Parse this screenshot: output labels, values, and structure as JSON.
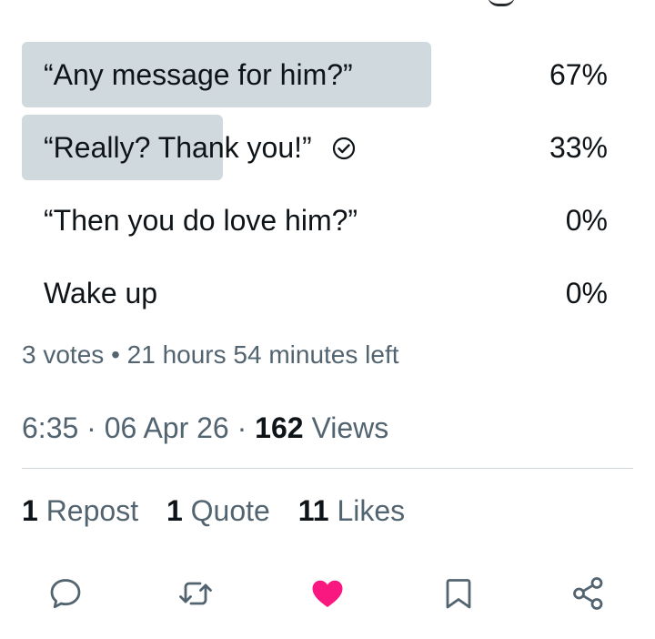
{
  "poll": {
    "options": [
      {
        "label": "“Any message for him?”",
        "percent": "67%",
        "share": 0.67,
        "voted": false
      },
      {
        "label": "“Really? Thank you!”",
        "percent": "33%",
        "share": 0.33,
        "voted": true
      },
      {
        "label": "“Then you do love him?”",
        "percent": "0%",
        "share": 0,
        "voted": false
      },
      {
        "label": "Wake up",
        "percent": "0%",
        "share": 0,
        "voted": false
      }
    ],
    "votes": "3 votes",
    "separator": "•",
    "time_left": "21 hours 54 minutes left"
  },
  "post": {
    "time": "6:35",
    "date": "06 Apr 26",
    "dot": "·",
    "views_count": "162",
    "views_label": "Views"
  },
  "stats": {
    "repost_count": "1",
    "repost_label": "Repost",
    "quote_count": "1",
    "quote_label": "Quote",
    "likes_count": "11",
    "likes_label": "Likes"
  },
  "actions": {
    "icons": [
      "reply-icon",
      "repost-icon",
      "like-icon",
      "bookmark-icon",
      "share-icon"
    ],
    "liked": true
  },
  "colors": {
    "poll_bar": "#cfd9de",
    "secondary_text": "#536471",
    "primary_text": "#0f1419",
    "like_active": "#f91880",
    "divider": "#cfd9de"
  }
}
